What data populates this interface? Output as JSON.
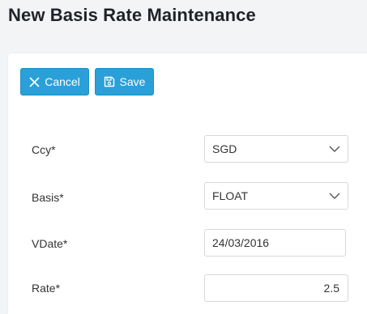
{
  "page": {
    "title": "New Basis Rate Maintenance"
  },
  "toolbar": {
    "cancel_label": "Cancel",
    "save_label": "Save"
  },
  "form": {
    "ccy": {
      "label": "Ccy*",
      "value": "SGD"
    },
    "basis": {
      "label": "Basis*",
      "value": "FLOAT"
    },
    "vdate": {
      "label": "VDate*",
      "value": "24/03/2016"
    },
    "rate": {
      "label": "Rate*",
      "value": "2.5"
    }
  },
  "icons": {
    "cancel": "close-icon",
    "save": "floppy-disk-icon",
    "dropdown": "chevron-down-icon"
  },
  "colors": {
    "button_bg": "#2aa0d8",
    "button_text": "#ffffff",
    "title": "#1f2329"
  }
}
